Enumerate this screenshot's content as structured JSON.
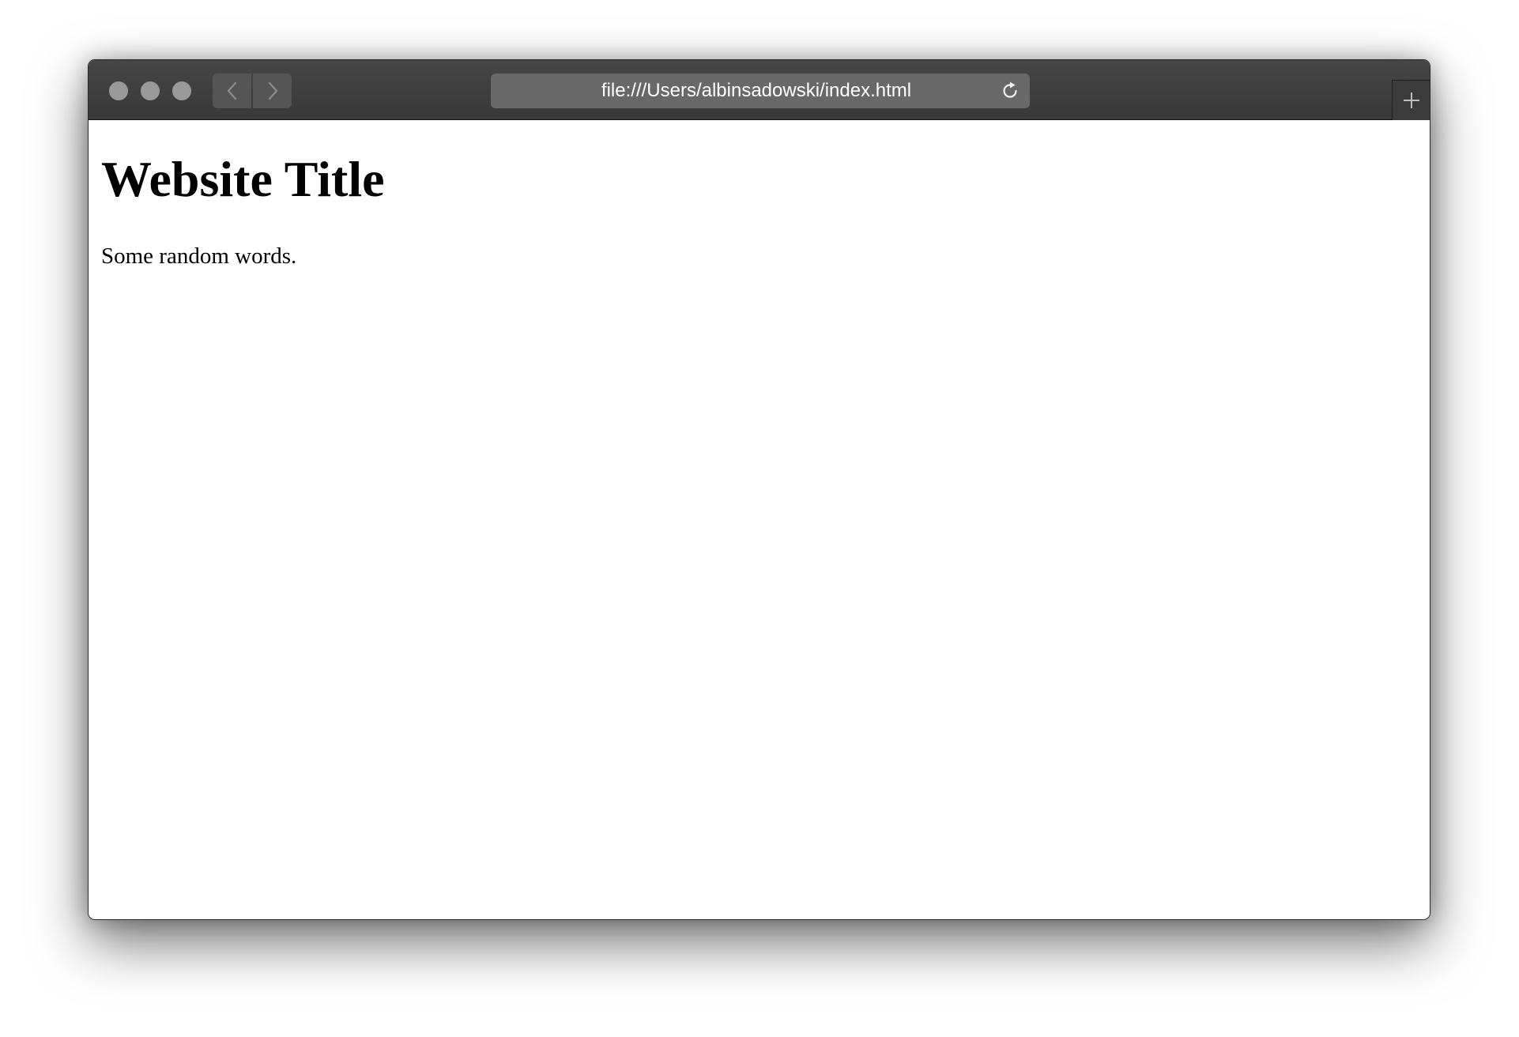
{
  "browser": {
    "address_bar": {
      "url": "file:///Users/albinsadowski/index.html"
    },
    "icons": {
      "back": "chevron-left-icon",
      "forward": "chevron-right-icon",
      "reload": "reload-icon",
      "new_tab": "plus-icon"
    },
    "colors": {
      "toolbar": "#3f3f3f",
      "address_bar": "#686868",
      "traffic_light": "#9a9a9a",
      "nav_button": "#555555"
    }
  },
  "page": {
    "title": "Website Title",
    "paragraph": "Some random words."
  }
}
